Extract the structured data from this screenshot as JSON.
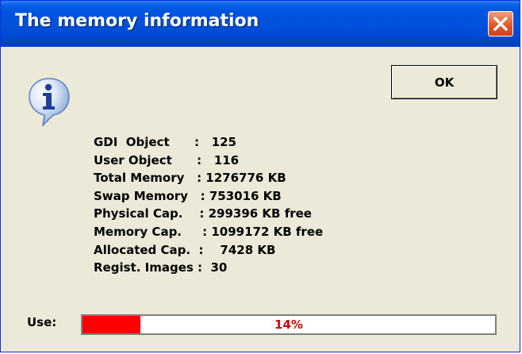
{
  "window": {
    "title": "The memory information"
  },
  "buttons": {
    "ok_label": "OK"
  },
  "stats": [
    {
      "label": "GDI  Object      :   125"
    },
    {
      "label": "User Object      :   116"
    },
    {
      "label": "Total Memory   : 1276776 KB"
    },
    {
      "label": "Swap Memory   : 753016 KB"
    },
    {
      "label": "Physical Cap.    : 299396 KB free"
    },
    {
      "label": "Memory Cap.     : 1099172 KB free"
    },
    {
      "label": "Allocated Cap.  :    7428 KB"
    },
    {
      "label": "Regist. Images :  30"
    }
  ],
  "usage": {
    "label": "Use:",
    "percent": 14,
    "percent_text": "14%",
    "fill_color": "#ff0000",
    "text_color": "#d40000"
  },
  "icons": {
    "info": "info-icon",
    "close": "close-icon"
  },
  "colors": {
    "titlebar": "#0054e3",
    "dialog_background": "#ece9d8",
    "close_button": "#e05a2c"
  }
}
